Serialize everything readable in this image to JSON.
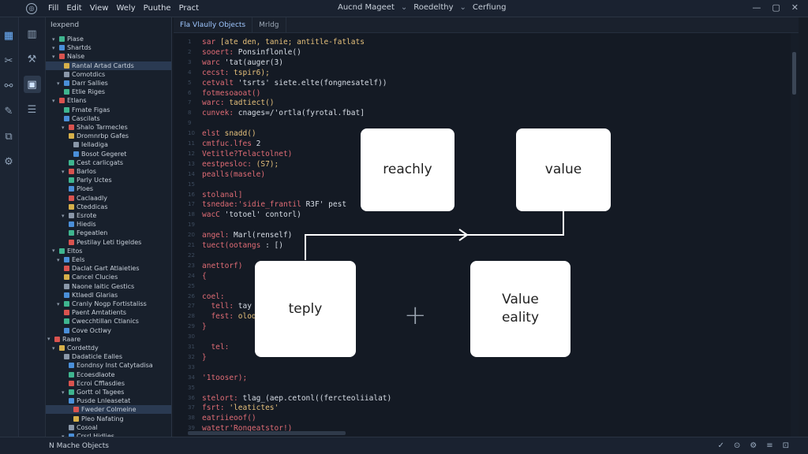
{
  "titlebar": {
    "menu": [
      "Fill",
      "Edit",
      "View",
      "Wely",
      "Puuthe",
      "Pract"
    ],
    "center_text": [
      "Aucnd Mageet",
      "Roedelthy",
      "Cerfiung"
    ],
    "controls": [
      "—",
      "▢",
      "✕"
    ]
  },
  "explorer": {
    "title": "Iexpend",
    "items": [
      {
        "label": "Piase",
        "indent": 1
      },
      {
        "label": "Shartds",
        "indent": 1
      },
      {
        "label": "Nalse",
        "indent": 1
      },
      {
        "label": "Rantal Artad Cartds",
        "indent": 2,
        "selected": true
      },
      {
        "label": "Comotdics",
        "indent": 2
      },
      {
        "label": "Darr Sallies",
        "indent": 2
      },
      {
        "label": "Etlie Riges",
        "indent": 2
      },
      {
        "label": "Etlans",
        "indent": 1
      },
      {
        "label": "Fmate Figas",
        "indent": 2
      },
      {
        "label": "Cascilats",
        "indent": 2
      },
      {
        "label": "Shalo Tarmecles",
        "indent": 3
      },
      {
        "label": "Dromnrbp Gafes",
        "indent": 3
      },
      {
        "label": "Ielladiga",
        "indent": 4
      },
      {
        "label": "Bosot Gegeret",
        "indent": 4
      },
      {
        "label": "Cest carlicgats",
        "indent": 3
      },
      {
        "label": "Barlos",
        "indent": 3
      },
      {
        "label": "Parly Uctes",
        "indent": 3
      },
      {
        "label": "Ploes",
        "indent": 3
      },
      {
        "label": "Caclaadly",
        "indent": 3
      },
      {
        "label": "Cteddicas",
        "indent": 3
      },
      {
        "label": "Esrote",
        "indent": 3
      },
      {
        "label": "Hiedis",
        "indent": 3
      },
      {
        "label": "Fegeatlen",
        "indent": 3
      },
      {
        "label": "Pestilay Leti tigeldes",
        "indent": 3
      },
      {
        "label": "Eltos",
        "indent": 1
      },
      {
        "label": "Eels",
        "indent": 2
      },
      {
        "label": "Daclat Gart Atlaieties",
        "indent": 2
      },
      {
        "label": "Cancel Clucies",
        "indent": 2
      },
      {
        "label": "Naone laitic Gestics",
        "indent": 2
      },
      {
        "label": "Ktlaedl Glarias",
        "indent": 2
      },
      {
        "label": "Cranly Nogp Fortistaliss",
        "indent": 2
      },
      {
        "label": "Paent Amtatients",
        "indent": 2
      },
      {
        "label": "Cwecchtillan Ctlanics",
        "indent": 2
      },
      {
        "label": "Cove Octlwy",
        "indent": 2
      },
      {
        "label": "Raare",
        "indent": 0
      },
      {
        "label": "Cordettdy",
        "indent": 1
      },
      {
        "label": "Dadaticle Ealles",
        "indent": 2
      },
      {
        "label": "Eondnsy Inst Catytadisa",
        "indent": 3
      },
      {
        "label": "Ecoesdlaote",
        "indent": 3
      },
      {
        "label": "Ecroi Cfflasdies",
        "indent": 3
      },
      {
        "label": "Gortt ol Tagees",
        "indent": 3
      },
      {
        "label": "Pusde Lnleasetat",
        "indent": 3
      },
      {
        "label": "Fweder Colmeine",
        "indent": 4,
        "selected": true
      },
      {
        "label": "Pleo Nafating",
        "indent": 4
      },
      {
        "label": "Cosoal",
        "indent": 3
      },
      {
        "label": "Crsrl Hidlies",
        "indent": 3
      }
    ]
  },
  "editor": {
    "tabs": [
      "Fla Vlaully Objects",
      "Mrldg"
    ],
    "code_lines": [
      "sar [ate den, tanie; antitle-fatlats",
      "sooert: Ponsinflonle()",
      "warc 'tat(auger(3)",
      "cecst: tspir6);",
      "cetvalt 'tsrts' siete.elte(fongnesatelf))",
      "fotmesoaoat()",
      "warc: tadtiect()",
      "cunvek: cnages=/'ortla(fyrotal.fbat]",
      "",
      "elst snadd()",
      "cmtfuc.lfes 2",
      "Vetitle?Telactolnet)",
      "eestpesloc: (S7);",
      "pealls(masele)",
      "",
      "stolanal]",
      "tsnedae:'sidie_frantil R3F' pest",
      "wacC 'totoel' contorl)",
      "",
      "angel: Marl(renself)",
      "tuect(ootangs : [)",
      "",
      "anettorf)",
      "{",
      "",
      "coel:",
      "  tell: tay",
      "  fest: oloq",
      "}",
      "",
      "  tel:",
      "}",
      "",
      "'1tooser);",
      "",
      "stelort: tlag_(aep.cetonl((fercteoliialat)",
      "fsrt: 'leatictes'",
      "eatriieoof()",
      "watetr'Rongeatstor!)"
    ],
    "line_numbers": [
      "1",
      "2",
      "3",
      "4",
      "5",
      "6",
      "7",
      "8",
      "9",
      "10",
      "11",
      "12",
      "13",
      "14",
      "15",
      "16",
      "17",
      "18",
      "19",
      "20",
      "21",
      "22",
      "23",
      "24",
      "25",
      "26",
      "27",
      "28",
      "29",
      "30",
      "31",
      "32",
      "33",
      "34",
      "35",
      "36",
      "37",
      "38",
      "39"
    ]
  },
  "diagram": {
    "boxes": [
      {
        "id": "reachly",
        "label": "reachly"
      },
      {
        "id": "value-top",
        "label": "value"
      },
      {
        "id": "teply",
        "label": "teply"
      },
      {
        "id": "value-eality",
        "label": "Value\neality"
      }
    ],
    "plus_symbol": "+"
  },
  "statusbar": {
    "left_text": "N Mache Objects",
    "right_icons": [
      "✓",
      "⊙",
      "⚙",
      "≡",
      "⊡"
    ]
  }
}
